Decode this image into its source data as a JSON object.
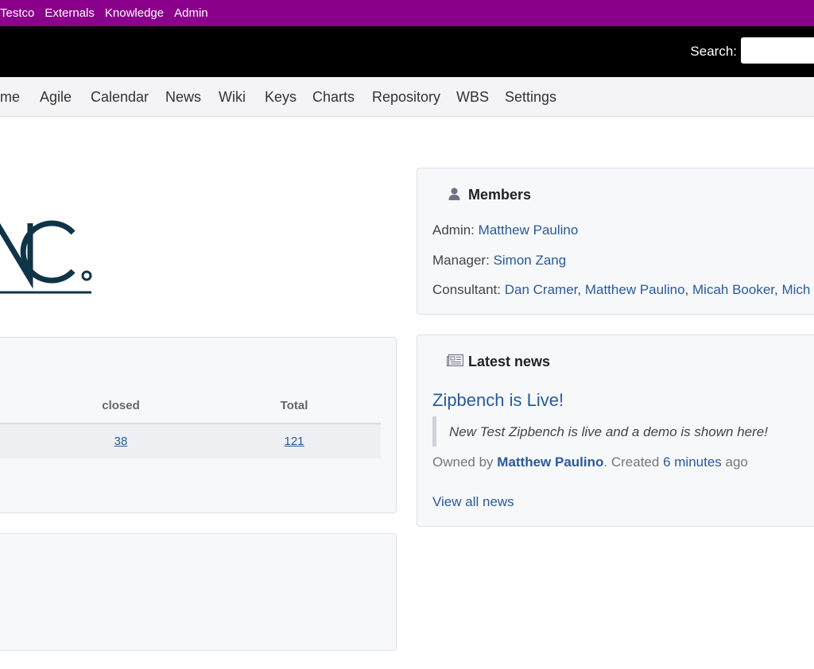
{
  "topbar": {
    "links": [
      "Testco",
      "Externals",
      "Knowledge",
      "Admin"
    ]
  },
  "header": {
    "search_label": "Search:",
    "search_value": ""
  },
  "nav": {
    "items": [
      "me",
      "Agile",
      "Calendar",
      "News",
      "Wiki",
      "Keys",
      "Charts",
      "Repository",
      "WBS",
      "Settings"
    ]
  },
  "logo": {
    "text": "NC."
  },
  "issues": {
    "columns": [
      "closed",
      "Total"
    ],
    "row": [
      "38",
      "121"
    ]
  },
  "members": {
    "title": "Members",
    "icon": "user-icon",
    "admin_label": "Admin:",
    "admin": "Matthew Paulino",
    "manager_label": "Manager:",
    "manager": "Simon Zang",
    "consultant_label": "Consultant:",
    "consultants": [
      "Dan Cramer",
      "Matthew Paulino",
      "Micah Booker",
      "Mich"
    ]
  },
  "news": {
    "title": "Latest news",
    "icon": "newspaper-icon",
    "item_title": "Zipbench is Live!",
    "item_summary": "New Test Zipbench is live and a demo is shown here!",
    "owned_by": "Owned by",
    "author": "Matthew Paulino",
    "created": ". Created",
    "time": "6 minutes",
    "ago": "ago",
    "view_all": "View all news"
  },
  "colors": {
    "topbar": "#8b008b",
    "header": "#000000",
    "link": "#2a5a9a",
    "logo": "#0f3447"
  }
}
